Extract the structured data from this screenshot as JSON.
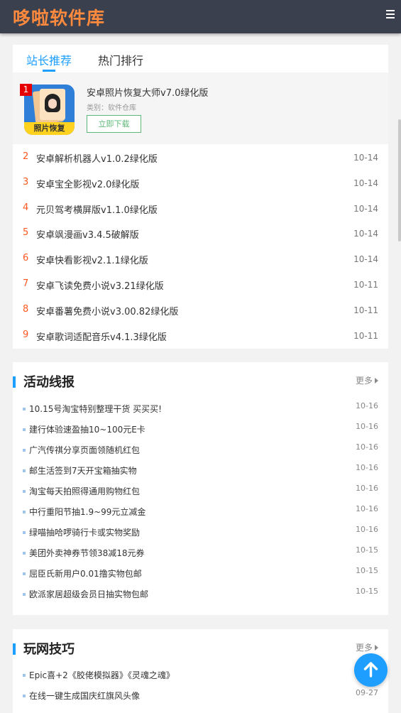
{
  "header": {
    "logo": "哆啦软件库"
  },
  "tabs": [
    {
      "label": "站长推荐"
    },
    {
      "label": "热门排行"
    }
  ],
  "featured": {
    "rank": "1",
    "title": "安卓照片恢复大师v7.0绿化版",
    "category": "类别：软件仓库",
    "icon_label": "照片恢复",
    "download_label": "立即下载"
  },
  "ranking": [
    {
      "rank": "2",
      "name": "安卓解析机器人v1.0.2绿化版",
      "date": "10-14"
    },
    {
      "rank": "3",
      "name": "安卓宝全影视v2.0绿化版",
      "date": "10-14"
    },
    {
      "rank": "4",
      "name": "元贝驾考横屏版v1.1.0绿化版",
      "date": "10-14"
    },
    {
      "rank": "5",
      "name": "安卓飒漫画v3.4.5破解版",
      "date": "10-14"
    },
    {
      "rank": "6",
      "name": "安卓快看影视v2.1.1绿化版",
      "date": "10-14"
    },
    {
      "rank": "7",
      "name": "安卓飞读免费小说v3.21绿化版",
      "date": "10-11"
    },
    {
      "rank": "8",
      "name": "安卓番薯免费小说v3.00.82绿化版",
      "date": "10-11"
    },
    {
      "rank": "9",
      "name": "安卓歌词适配音乐v4.1.3绿化版",
      "date": "10-11"
    }
  ],
  "activity": {
    "title": "活动线报",
    "more": "更多",
    "items": [
      {
        "name": "10.15号淘宝特别整理干货 买买买!",
        "date": "10-16"
      },
      {
        "name": "建行体验速盈抽10~100元E卡",
        "date": "10-16"
      },
      {
        "name": "广汽传祺分享页面领随机红包",
        "date": "10-16"
      },
      {
        "name": "邮生活签到7天开宝箱抽实物",
        "date": "10-16"
      },
      {
        "name": "淘宝每天拍照得通用购物红包",
        "date": "10-16"
      },
      {
        "name": "中行重阳节抽1.9~99元立减金",
        "date": "10-16"
      },
      {
        "name": "绿喵抽哈啰骑行卡或实物奖励",
        "date": "10-16"
      },
      {
        "name": "美团外卖神券节领38减18元券",
        "date": "10-15"
      },
      {
        "name": "屈臣氏新用户0.01撸实物包邮",
        "date": "10-15"
      },
      {
        "name": "欧派家居超级会员日抽实物包邮",
        "date": "10-15"
      }
    ]
  },
  "tips": {
    "title": "玩网技巧",
    "more": "更多",
    "items": [
      {
        "name": "Epic喜+2《胶佬模拟器》《灵魂之魂》",
        "date": ""
      },
      {
        "name": "在线一键生成国庆红旗风头像",
        "date": "09-27"
      }
    ]
  },
  "colors": {
    "accent": "#1e9fff",
    "rank": "#ff5722",
    "header_bg": "#3a404e",
    "logo": "#ff8a3d",
    "download": "#5fb878"
  },
  "icons": {
    "menu": "hamburger-menu-icon",
    "back_to_top": "arrow-up-icon",
    "more": "caret-right-icon"
  }
}
